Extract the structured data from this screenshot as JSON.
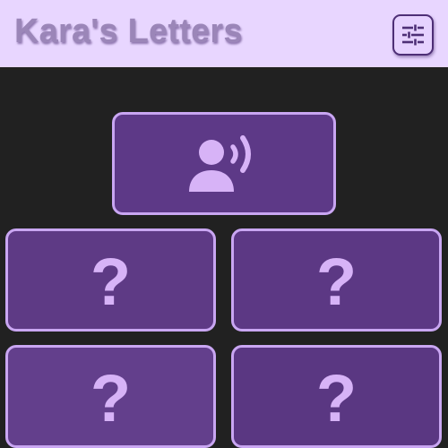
{
  "app": {
    "title": "Kara's Letters"
  },
  "toolbar": {
    "settings_icon": "sliders-icon"
  },
  "speak_card": {
    "icon": "person-speaking-icon"
  },
  "letter_cards": [
    {
      "label": "?"
    },
    {
      "label": "?"
    },
    {
      "label": "?"
    },
    {
      "label": "?"
    }
  ],
  "colors": {
    "header_bg": "#e8d6ff",
    "page_bg": "#212121",
    "card_bg": "#5e3a85",
    "card_border": "#c9a6f2",
    "card_glyph": "#d7b3f7",
    "title_text": "#9b86b8"
  }
}
